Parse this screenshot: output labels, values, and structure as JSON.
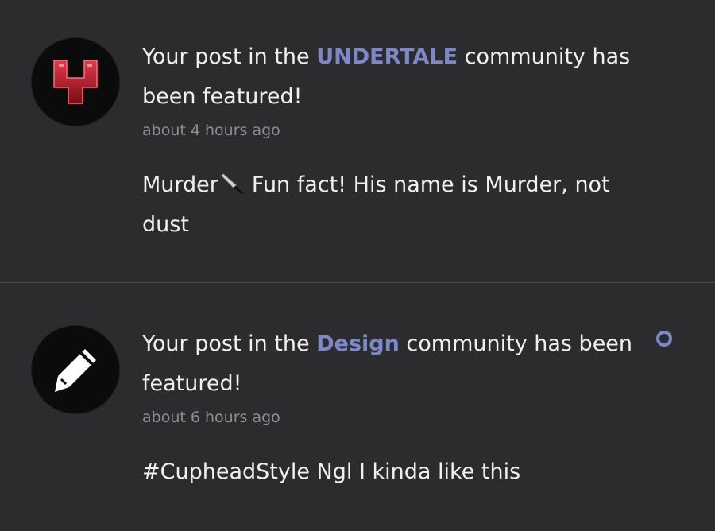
{
  "notifications": [
    {
      "headline_prefix": "Your post in the ",
      "community": "UNDERTALE",
      "headline_suffix": " community has been featured!",
      "timestamp": "about 4 hours ago",
      "post_title": "Murder",
      "post_body": "Fun fact! His name is Murder, not dust",
      "avatar_icon": "undertale-logo-icon",
      "unread": false
    },
    {
      "headline_prefix": "Your post in the ",
      "community": "Design",
      "headline_suffix": " community has been featured!",
      "timestamp": "about 6 hours ago",
      "post_text": "#CupheadStyle Ngl I kinda like this",
      "avatar_icon": "pencil-icon",
      "unread": true
    }
  ],
  "colors": {
    "background": "#2c2c2e",
    "accent": "#7b88c9",
    "text": "#f0f0f0",
    "muted": "#8e8e92",
    "divider": "#4a4a4c"
  }
}
